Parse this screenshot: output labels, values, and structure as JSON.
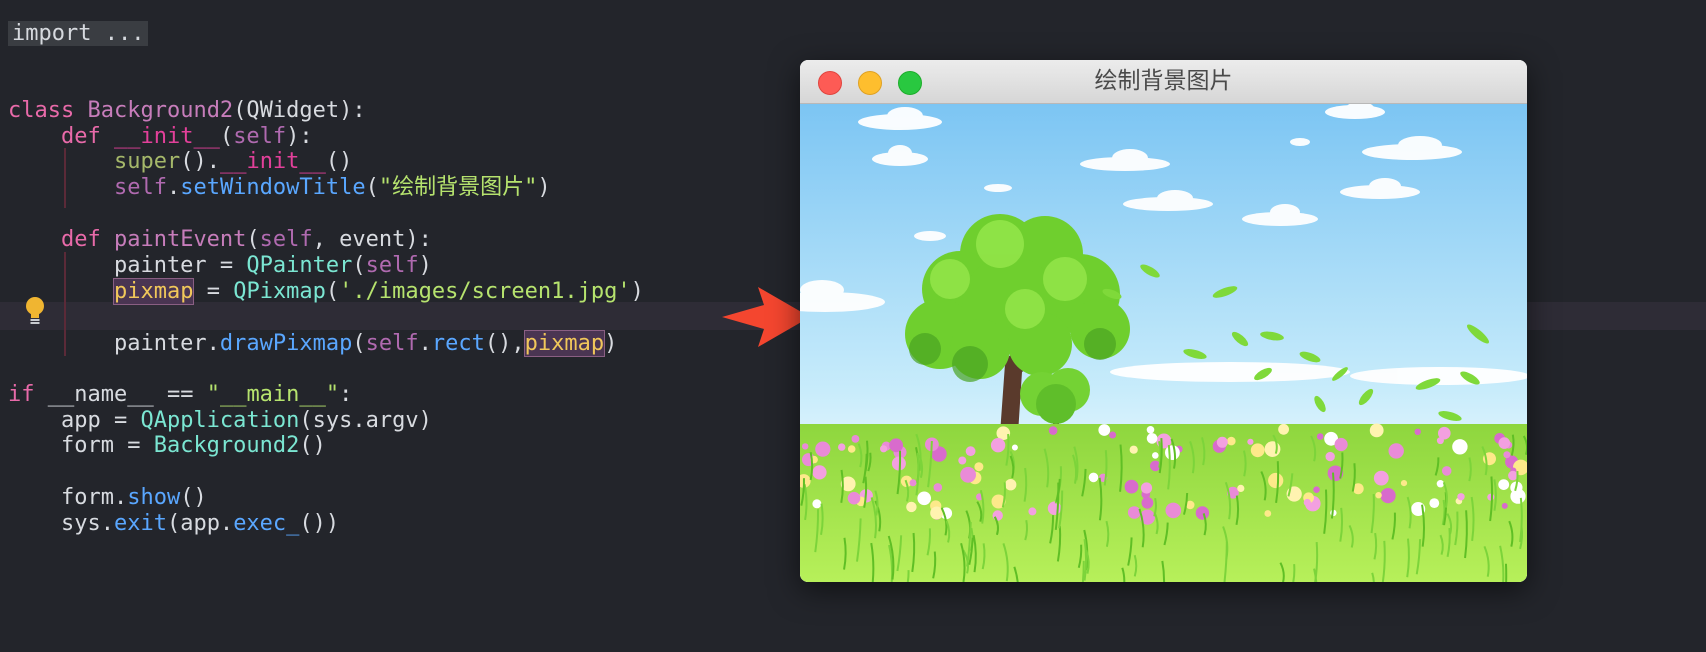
{
  "editor": {
    "lines": [
      {
        "key": "l0",
        "tokens": [
          {
            "t": "import ...",
            "c": "import-box"
          }
        ]
      },
      {
        "key": "l1",
        "tokens": [
          {
            "t": "class ",
            "c": "tok-kw"
          },
          {
            "t": "Background2",
            "c": "tok-cls"
          },
          {
            "t": "(QWidget):",
            "c": "tok-plain"
          }
        ]
      },
      {
        "key": "l2",
        "tokens": [
          {
            "t": "    "
          },
          {
            "t": "def ",
            "c": "tok-kw"
          },
          {
            "t": "__init__",
            "c": "tok-dund"
          },
          {
            "t": "(",
            "c": "tok-plain"
          },
          {
            "t": "self",
            "c": "tok-self"
          },
          {
            "t": "):",
            "c": "tok-plain"
          }
        ]
      },
      {
        "key": "l3",
        "tokens": [
          {
            "t": "        "
          },
          {
            "t": "super",
            "c": "tok-sup"
          },
          {
            "t": "().",
            "c": "tok-plain"
          },
          {
            "t": "__init__",
            "c": "tok-dund"
          },
          {
            "t": "()",
            "c": "tok-plain"
          }
        ]
      },
      {
        "key": "l4",
        "tokens": [
          {
            "t": "        "
          },
          {
            "t": "self",
            "c": "tok-self"
          },
          {
            "t": ".",
            "c": "tok-plain"
          },
          {
            "t": "setWindowTitle",
            "c": "tok-fn"
          },
          {
            "t": "(",
            "c": "tok-plain"
          },
          {
            "t": "\"绘制背景图片\"",
            "c": "tok-str"
          },
          {
            "t": ")",
            "c": "tok-plain"
          }
        ]
      },
      {
        "key": "l5",
        "tokens": []
      },
      {
        "key": "l6",
        "tokens": [
          {
            "t": "    "
          },
          {
            "t": "def ",
            "c": "tok-kw"
          },
          {
            "t": "paintEvent",
            "c": "tok-cls"
          },
          {
            "t": "(",
            "c": "tok-plain"
          },
          {
            "t": "self",
            "c": "tok-self"
          },
          {
            "t": ", event):",
            "c": "tok-plain"
          }
        ]
      },
      {
        "key": "l7",
        "tokens": [
          {
            "t": "        painter = ",
            "c": "tok-plain"
          },
          {
            "t": "QPainter",
            "c": "tok-qt"
          },
          {
            "t": "(",
            "c": "tok-plain"
          },
          {
            "t": "self",
            "c": "tok-self"
          },
          {
            "t": ")",
            "c": "tok-plain"
          }
        ]
      },
      {
        "key": "l8",
        "tokens": [
          {
            "t": "        "
          },
          {
            "t": "pixmap",
            "c": "tok-var"
          },
          {
            "t": " = ",
            "c": "tok-plain"
          },
          {
            "t": "QPixmap",
            "c": "tok-qt"
          },
          {
            "t": "(",
            "c": "tok-plain"
          },
          {
            "t": "'./images/screen1.jpg'",
            "c": "tok-str"
          },
          {
            "t": ")",
            "c": "tok-plain"
          }
        ]
      },
      {
        "key": "l9",
        "tokens": []
      },
      {
        "key": "l10",
        "tokens": [
          {
            "t": "        painter.",
            "c": "tok-plain"
          },
          {
            "t": "drawPixmap",
            "c": "tok-fn"
          },
          {
            "t": "(",
            "c": "tok-plain"
          },
          {
            "t": "self",
            "c": "tok-self"
          },
          {
            "t": ".",
            "c": "tok-plain"
          },
          {
            "t": "rect",
            "c": "tok-fn"
          },
          {
            "t": "(),",
            "c": "tok-plain"
          },
          {
            "t": "pixmap",
            "c": "tok-var"
          },
          {
            "t": ")",
            "c": "tok-plain"
          }
        ]
      },
      {
        "key": "l11",
        "tokens": []
      },
      {
        "key": "l12",
        "tokens": [
          {
            "t": "if ",
            "c": "tok-kw"
          },
          {
            "t": "__name__ == ",
            "c": "tok-plain"
          },
          {
            "t": "\"__main__\"",
            "c": "tok-str"
          },
          {
            "t": ":",
            "c": "tok-plain"
          }
        ]
      },
      {
        "key": "l13",
        "tokens": [
          {
            "t": "    app = ",
            "c": "tok-plain"
          },
          {
            "t": "QApplication",
            "c": "tok-qt"
          },
          {
            "t": "(sys.argv)",
            "c": "tok-plain"
          }
        ]
      },
      {
        "key": "l14",
        "tokens": [
          {
            "t": "    form = ",
            "c": "tok-plain"
          },
          {
            "t": "Background2",
            "c": "tok-qt"
          },
          {
            "t": "()",
            "c": "tok-plain"
          }
        ]
      },
      {
        "key": "l15",
        "tokens": []
      },
      {
        "key": "l16",
        "tokens": [
          {
            "t": "    form.",
            "c": "tok-plain"
          },
          {
            "t": "show",
            "c": "tok-fn"
          },
          {
            "t": "()",
            "c": "tok-plain"
          }
        ]
      },
      {
        "key": "l17",
        "tokens": [
          {
            "t": "    sys.",
            "c": "tok-plain"
          },
          {
            "t": "exit",
            "c": "tok-fn"
          },
          {
            "t": "(app.",
            "c": "tok-plain"
          },
          {
            "t": "exec_",
            "c": "tok-fn"
          },
          {
            "t": "())",
            "c": "tok-plain"
          }
        ]
      }
    ],
    "intention_icon": "lightbulb-icon"
  },
  "window": {
    "title": "绘制背景图片",
    "buttons": {
      "close": "close-icon",
      "minimize": "minimize-icon",
      "maximize": "maximize-icon"
    }
  },
  "colors": {
    "editor_bg": "#23252b",
    "arrow": "#f4462f",
    "sky_top": "#7fc8f4",
    "sky_bottom": "#e3f6ff",
    "grass": "#a6e84a"
  }
}
